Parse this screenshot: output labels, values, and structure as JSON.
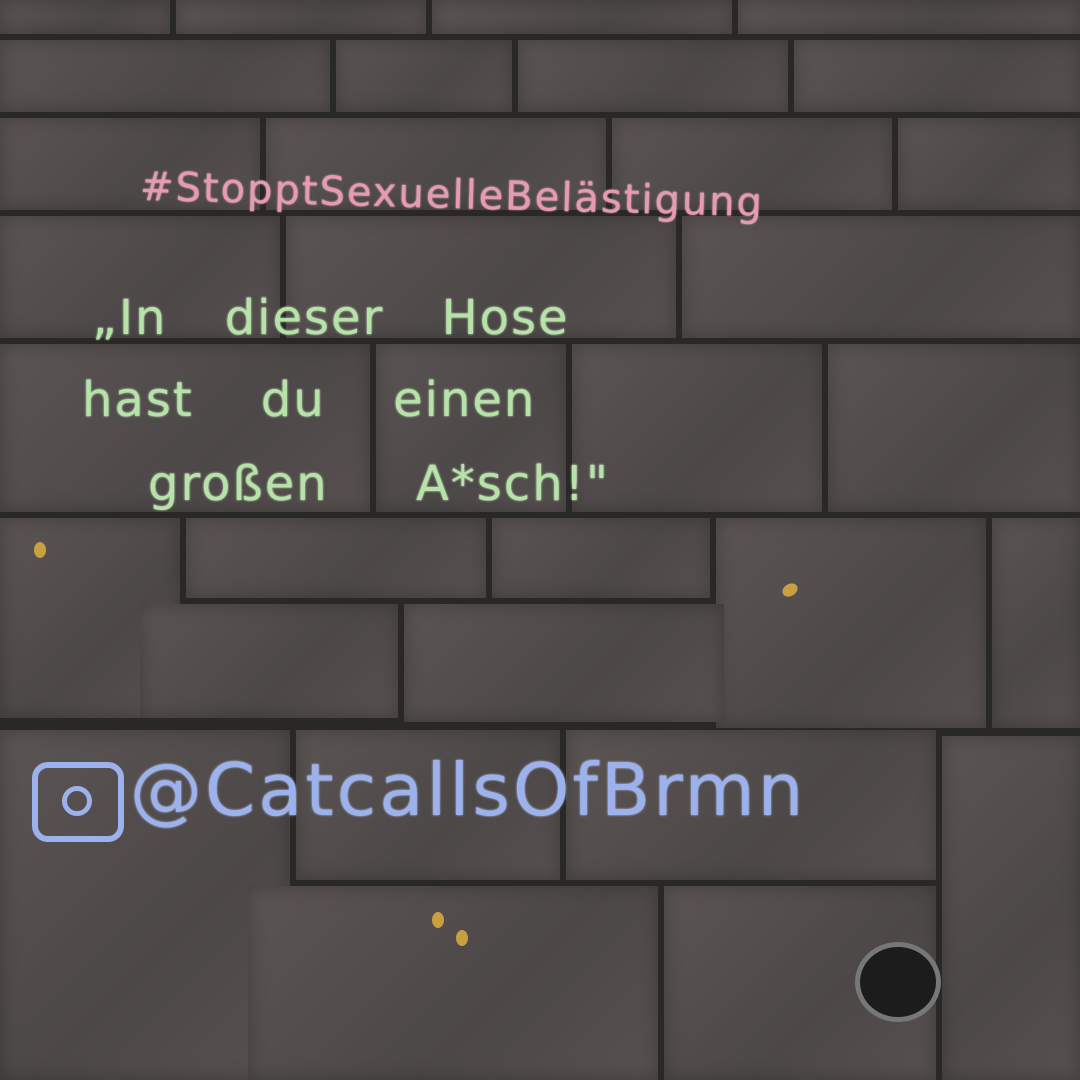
{
  "chalk_text": {
    "hashtag": "#StopptSexuelleBelästigung",
    "quote_line1": "„In dieser Hose",
    "quote_line2": "hast du einen",
    "quote_line3": "großen A*sch!\"",
    "handle": "@CatcallsOfBrmn"
  },
  "colors": {
    "hashtag": "#e89bb0",
    "quote": "#b6e3a8",
    "handle": "#9db2ec",
    "pavement": "#524c4b"
  },
  "icons": [
    "instagram-icon"
  ]
}
